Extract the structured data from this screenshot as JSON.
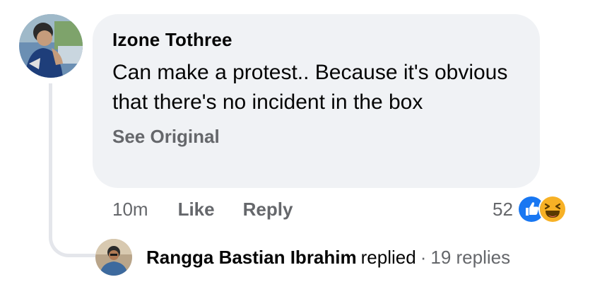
{
  "comment": {
    "author": "Izone Tothree",
    "text": "Can make a protest.. Because it's obvious that there's no incident in the box",
    "see_original": "See Original",
    "time": "10m",
    "like_label": "Like",
    "reply_label": "Reply",
    "reaction_count": "52",
    "reactions": [
      "like-reaction",
      "haha-reaction"
    ]
  },
  "reply_summary": {
    "name": "Rangga Bastian Ibrahim",
    "verb": "replied",
    "separator": "·",
    "count": "19 replies"
  },
  "colors": {
    "bubble": "#f0f2f5",
    "secondary_text": "#65676b",
    "like_blue": "#1877f2",
    "haha_yellow": "#f7b125",
    "thread_line": "#e4e6eb"
  }
}
